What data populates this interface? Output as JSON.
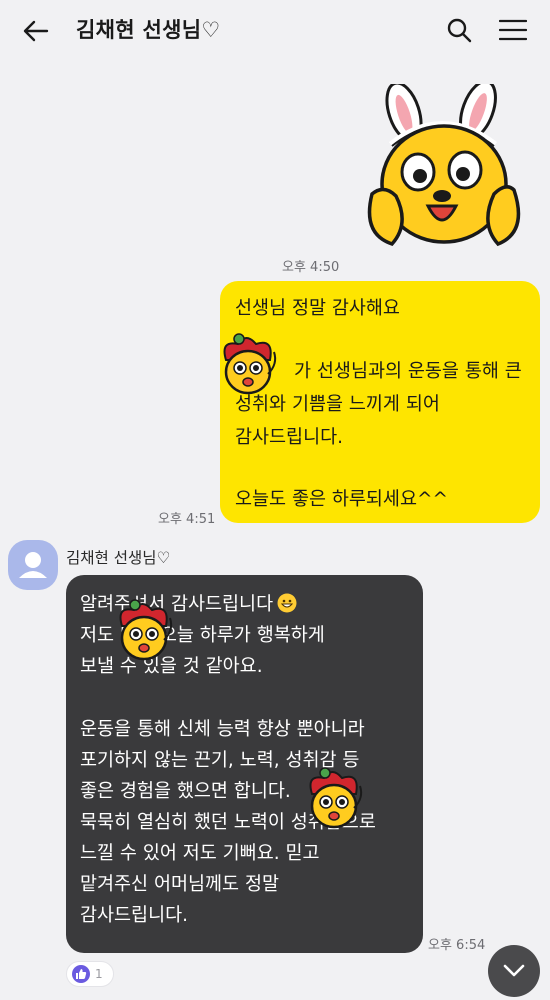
{
  "header": {
    "title": "김채현 선생님♡",
    "back_icon": "arrow-left-icon",
    "search_icon": "search-icon",
    "menu_icon": "hamburger-menu-icon"
  },
  "messages": [
    {
      "type": "sticker",
      "from": "me",
      "sticker": "bunny-ears-character",
      "time": "오후 4:50"
    },
    {
      "type": "text",
      "from": "me",
      "lines": [
        "선생님 정말 감사해요",
        "",
        "가 선생님과의 운동을 통해 큰",
        "성취와 기쁨을 느끼게 되어",
        "감사드립니다.",
        "",
        "오늘도 좋은 하루되세요^^"
      ],
      "time": "오후 4:51"
    },
    {
      "type": "text",
      "from": "them",
      "sender": "김채현 선생님♡",
      "lines": [
        "알려주셔서 감사드립니다",
        "저도 덕에 오늘 하루가 행복하게",
        "보낼 수 있을 것 같아요.",
        "",
        "운동을 통해 신체 능력 향상 뿐아니라",
        "포기하지 않는 끈기, 노력, 성취감 등",
        "좋은 경험을 했으면 합니다.",
        "묵묵히 열심히 했던 노력이 성취감으로",
        "느낄 수 있어 저도 기뻐요. 믿고",
        "맡겨주신 어머님께도 정말",
        "감사드립니다."
      ],
      "time": "오후 6:54",
      "reaction": {
        "icon": "thumbs-up-icon",
        "count": "1"
      }
    }
  ],
  "colors": {
    "background": "#f1f1f3",
    "my_bubble": "#fee500",
    "their_bubble": "#3a3a3c",
    "avatar": "#aab8ea",
    "reaction": "#6a5ae0"
  },
  "scroll_button_icon": "chevron-down-icon"
}
